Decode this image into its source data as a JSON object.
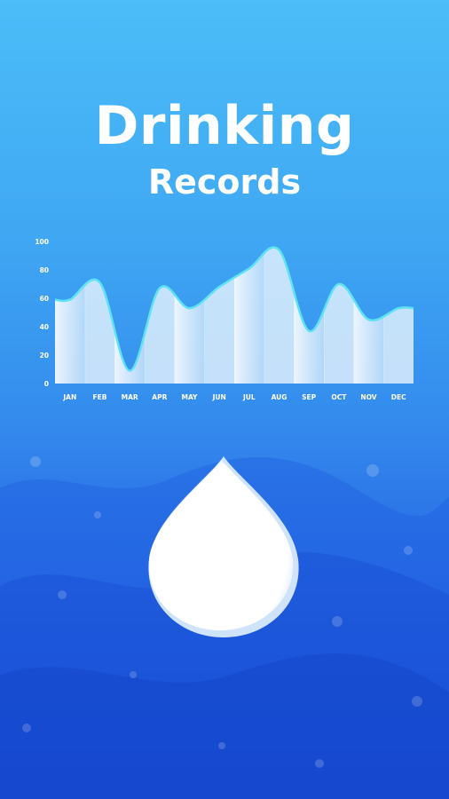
{
  "screen": {
    "title_main": "Drinking",
    "title_sub": "Records"
  },
  "colors": {
    "background_top": "#4cbdf8",
    "background_bottom": "#1b52dd",
    "curve_stroke": "#5fe3f0",
    "bar_fill": "#ffffff",
    "text": "#ffffff"
  },
  "icons": {
    "drop": "water-drop-icon"
  },
  "chart_data": {
    "type": "area",
    "categories": [
      "JAN",
      "FEB",
      "MAR",
      "APR",
      "MAY",
      "JUN",
      "JUL",
      "AUG",
      "SEP",
      "OCT",
      "NOV",
      "DEC"
    ],
    "values": [
      59,
      71,
      9,
      67,
      53,
      68,
      81,
      94,
      37,
      70,
      45,
      53
    ],
    "yticks": [
      0,
      20,
      40,
      60,
      80,
      100
    ],
    "ylim": [
      0,
      100
    ],
    "grid": false,
    "legend": "none"
  }
}
